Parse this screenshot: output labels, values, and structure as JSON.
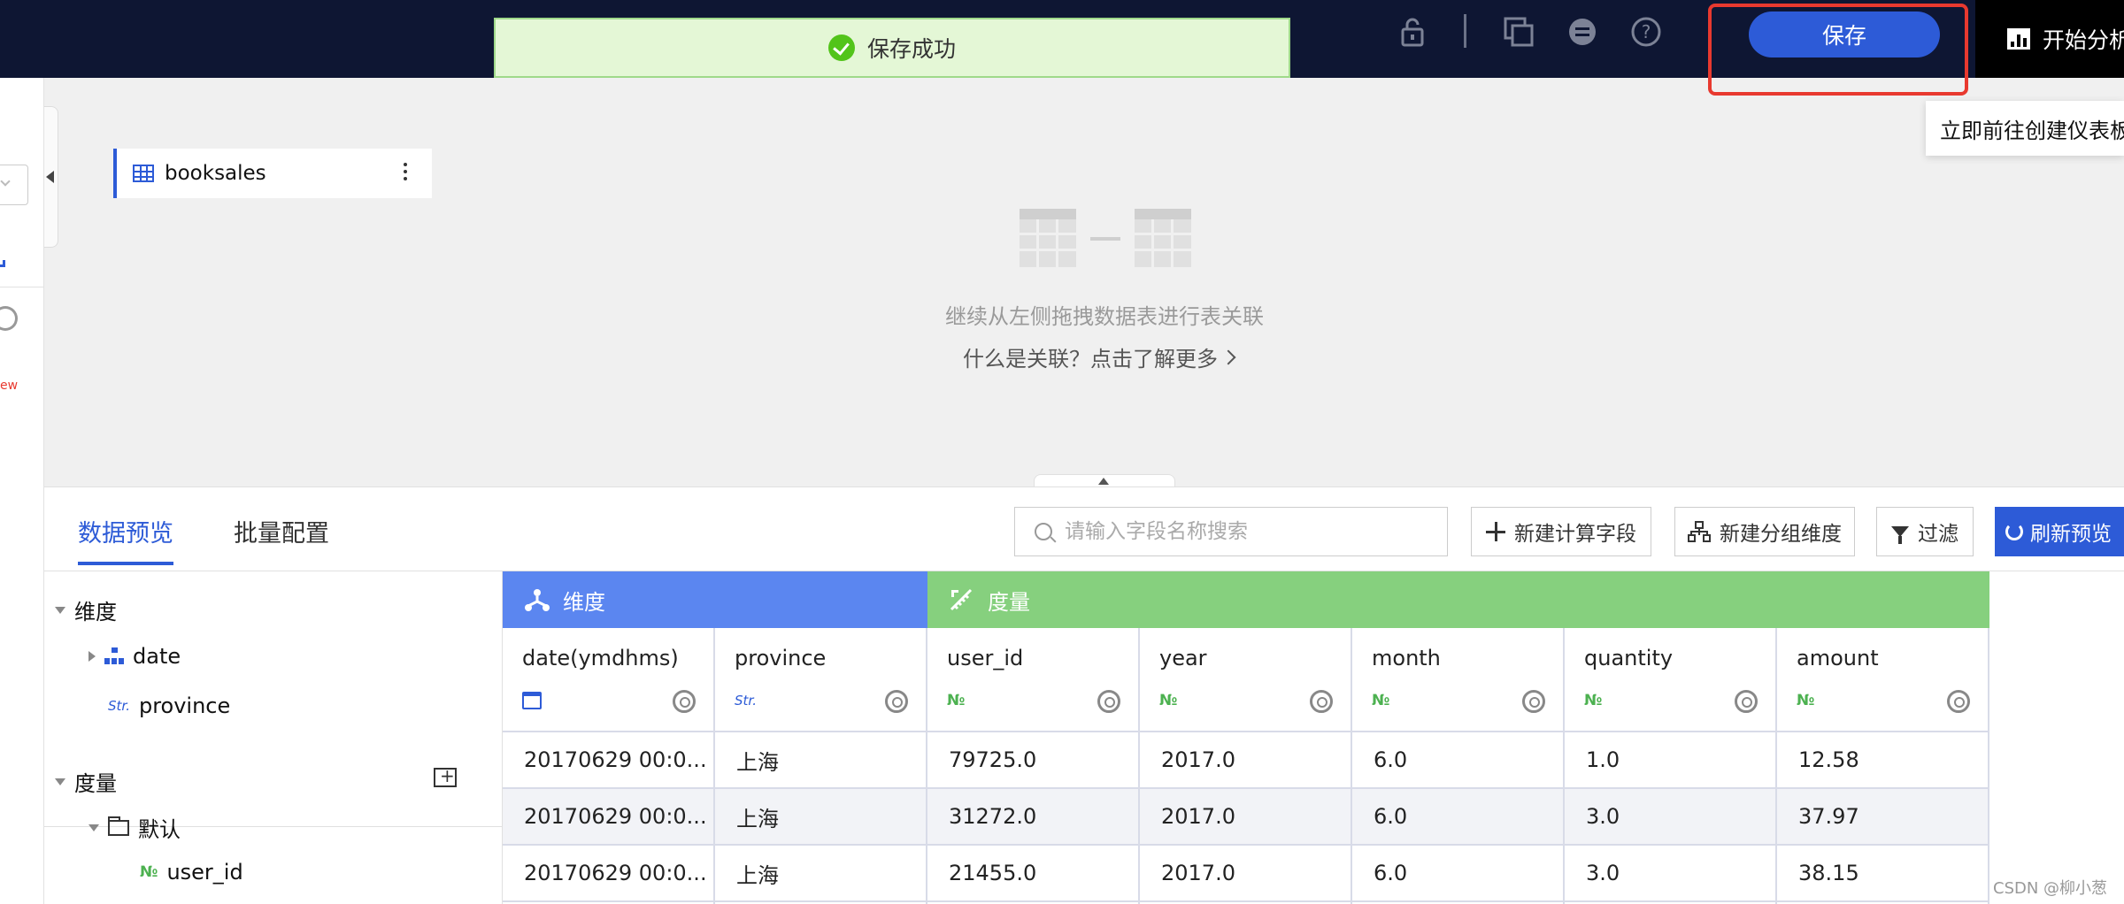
{
  "toast": {
    "message": "保存成功"
  },
  "topbar": {
    "save_label": "保存",
    "start_label": "开始分析",
    "tooltip": "立即前往创建仪表板",
    "icons": [
      "lock-icon",
      "copy-icon",
      "minus-circle-icon",
      "help-icon"
    ]
  },
  "canvas": {
    "table_name": "booksales",
    "hint": "继续从左侧拖拽数据表进行表关联",
    "link": "什么是关联？点击了解更多"
  },
  "leftstrip": {
    "badge": "ew"
  },
  "panel": {
    "tabs": [
      {
        "label": "数据预览",
        "active": true
      },
      {
        "label": "批量配置",
        "active": false
      }
    ],
    "search_placeholder": "请输入字段名称搜索",
    "buttons": {
      "new_calc": "新建计算字段",
      "new_group": "新建分组维度",
      "filter": "过滤",
      "refresh": "刷新预览"
    }
  },
  "tree": {
    "dimension_title": "维度",
    "dimension_items": [
      {
        "name": "date",
        "type": "hierarchy"
      },
      {
        "name": "province",
        "type": "Str."
      }
    ],
    "measure_title": "度量",
    "measure_folder": "默认",
    "measure_items": [
      {
        "name": "user_id",
        "type": "№"
      }
    ]
  },
  "grid": {
    "groups": {
      "dimension": "维度",
      "measure": "度量"
    },
    "columns": [
      {
        "name": "date(ymdhms)",
        "type": "date"
      },
      {
        "name": "province",
        "type": "Str."
      },
      {
        "name": "user_id",
        "type": "№"
      },
      {
        "name": "year",
        "type": "№"
      },
      {
        "name": "month",
        "type": "№"
      },
      {
        "name": "quantity",
        "type": "№"
      },
      {
        "name": "amount",
        "type": "№"
      }
    ],
    "rows": [
      [
        "20170629 00:0...",
        "上海",
        "79725.0",
        "2017.0",
        "6.0",
        "1.0",
        "12.58"
      ],
      [
        "20170629 00:0...",
        "上海",
        "31272.0",
        "2017.0",
        "6.0",
        "3.0",
        "37.97"
      ],
      [
        "20170629 00:0...",
        "上海",
        "21455.0",
        "2017.0",
        "6.0",
        "3.0",
        "38.15"
      ]
    ]
  },
  "watermark": "CSDN @柳小葱",
  "colors": {
    "topbar": "#0e1633",
    "accent": "#2d5bd7",
    "dimension_header": "#5b86f0",
    "measure_header": "#86d07e",
    "highlight": "#e8392f",
    "toast_bg": "#e4f7d6"
  }
}
